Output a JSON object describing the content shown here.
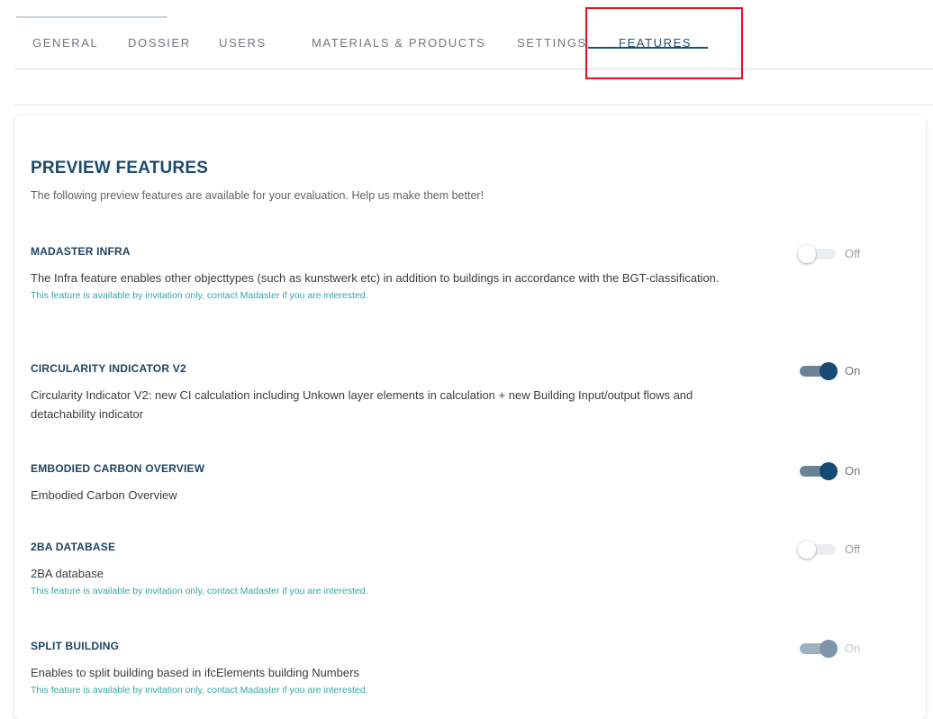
{
  "tabs": [
    {
      "label": "GENERAL"
    },
    {
      "label": "DOSSIER"
    },
    {
      "label": "USERS"
    },
    {
      "label": "MATERIALS & PRODUCTS"
    },
    {
      "label": "SETTINGS"
    },
    {
      "label": "FEATURES",
      "active": true
    }
  ],
  "preview": {
    "title": "PREVIEW FEATURES",
    "subtitle": "The following preview features are available for your evaluation. Help us make them better!"
  },
  "features": [
    {
      "name": "MADASTER INFRA",
      "description": "The Infra feature enables other objecttypes (such as kunstwerk etc) in addition to buildings in accordance with the BGT-classification.",
      "note": "This feature is available by invitation only, contact Madaster if you are interested.",
      "state_label": "Off"
    },
    {
      "name": "CIRCULARITY INDICATOR V2",
      "description": "Circularity Indicator V2: new CI calculation including Unkown layer elements in calculation + new Building Input/output flows and detachability indicator",
      "note": "",
      "state_label": "On"
    },
    {
      "name": "EMBODIED CARBON OVERVIEW",
      "description": "Embodied Carbon Overview",
      "note": "",
      "state_label": "On"
    },
    {
      "name": "2BA DATABASE",
      "description": "2BA database",
      "note": "This feature is available by invitation only, contact Madaster if you are interested.",
      "state_label": "Off"
    },
    {
      "name": "SPLIT BUILDING",
      "description": "Enables to split building based in ifcElements building Numbers",
      "note": "This feature is available by invitation only, contact Madaster if you are interested.",
      "state_label": "On"
    }
  ],
  "colors": {
    "accent": "#1d4a6d",
    "toggle_on": "#164a72",
    "note": "#32a6a3",
    "highlight": "#e8101b"
  }
}
